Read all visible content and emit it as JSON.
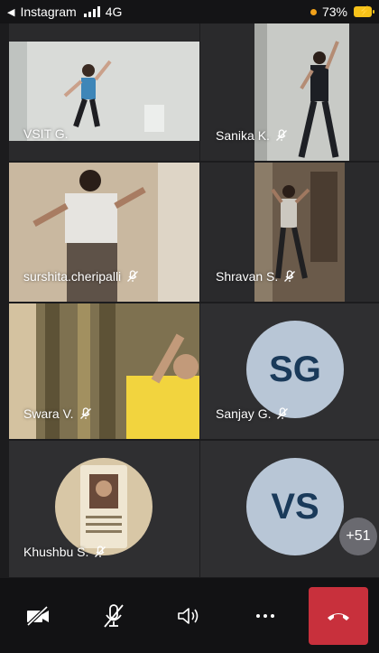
{
  "status_bar": {
    "back_app": "Instagram",
    "network": "4G",
    "battery": "73%"
  },
  "participants": [
    {
      "name": "VSIT G."
    },
    {
      "name": "Sanika K."
    },
    {
      "name": "surshita.cheripalli"
    },
    {
      "name": "Shravan S."
    },
    {
      "name": "Swara V."
    },
    {
      "name": "Sanjay G.",
      "initials": "SG"
    },
    {
      "name": "Khushbu S."
    },
    {
      "name": "",
      "initials": "VS"
    }
  ],
  "overflow_count": "+51",
  "controls": {
    "camera": "camera-off-icon",
    "mic": "mic-off-icon",
    "speaker": "speaker-icon",
    "more": "more-icon",
    "end": "end-call-icon",
    "end_color": "#c8303c"
  }
}
